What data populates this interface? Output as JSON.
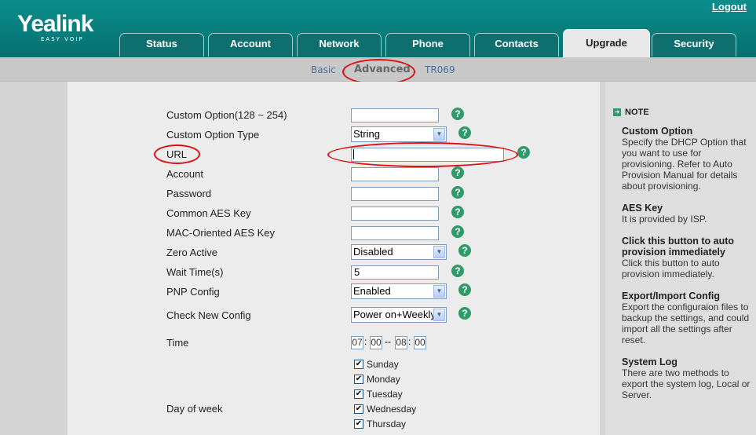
{
  "header": {
    "logo": "Yealink",
    "logo_tagline": "EASY VOIP",
    "logout": "Logout"
  },
  "tabs": [
    {
      "label": "Status"
    },
    {
      "label": "Account"
    },
    {
      "label": "Network"
    },
    {
      "label": "Phone"
    },
    {
      "label": "Contacts"
    },
    {
      "label": "Upgrade"
    },
    {
      "label": "Security"
    }
  ],
  "active_tab": "Upgrade",
  "subnav": {
    "basic": "Basic",
    "advanced": "Advanced",
    "tr069": "TR069",
    "separator": "|"
  },
  "form": {
    "custom_option": {
      "label": "Custom Option(128 ~ 254)",
      "value": ""
    },
    "custom_option_type": {
      "label": "Custom Option Type",
      "value": "String"
    },
    "url": {
      "label": "URL",
      "value": ""
    },
    "account": {
      "label": "Account",
      "value": ""
    },
    "password": {
      "label": "Password",
      "value": ""
    },
    "common_aes_key": {
      "label": "Common AES Key",
      "value": ""
    },
    "mac_aes_key": {
      "label": "MAC-Oriented AES Key",
      "value": ""
    },
    "zero_active": {
      "label": "Zero Active",
      "value": "Disabled"
    },
    "wait_time": {
      "label": "Wait Time(s)",
      "value": "5"
    },
    "pnp_config": {
      "label": "PNP Config",
      "value": "Enabled"
    },
    "check_new_config": {
      "label": "Check New Config",
      "value": "Power on+Weekly"
    },
    "time": {
      "label": "Time",
      "start_hour": "07",
      "start_min": "00",
      "end_hour": "08",
      "end_min": "00",
      "range_sep": "--",
      "colon": ":"
    },
    "day_of_week": {
      "label": "Day of week",
      "days": [
        {
          "name": "Sunday",
          "checked": true
        },
        {
          "name": "Monday",
          "checked": true
        },
        {
          "name": "Tuesday",
          "checked": true
        },
        {
          "name": "Wednesday",
          "checked": true
        },
        {
          "name": "Thursday",
          "checked": true
        }
      ]
    },
    "help_glyph": "?"
  },
  "note": {
    "title": "NOTE",
    "sections": [
      {
        "heading": "Custom Option",
        "body": "Specify the DHCP Option that you want to use for provisioning. Refer to Auto Provision Manual for details about provisioning."
      },
      {
        "heading": "AES Key",
        "body": "It is provided by ISP."
      },
      {
        "heading": "Click this button to auto provision immediately",
        "body": "Click this button to auto provision immediately."
      },
      {
        "heading": "Export/Import Config",
        "body": "Export the configuraion files to backup the settings, and could import all the settings after reset."
      },
      {
        "heading": "System Log",
        "body": "There are two methods to export the system log, Local or Server."
      }
    ]
  },
  "colors": {
    "header_teal": "#0b8e8c",
    "help_green": "#2f9a6a",
    "annotation_red": "#dd1111"
  }
}
